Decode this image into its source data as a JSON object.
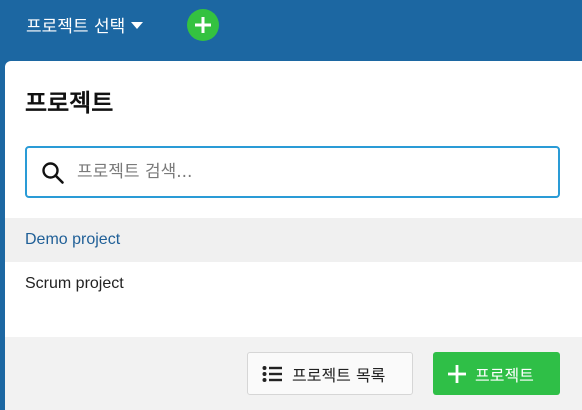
{
  "topbar": {
    "project_select_label": "프로젝트 선택",
    "add_icon": "plus-circle-icon"
  },
  "panel": {
    "title": "프로젝트",
    "search": {
      "placeholder": "프로젝트 검색...",
      "value": ""
    },
    "projects": [
      {
        "label": "Demo project",
        "state": "active"
      },
      {
        "label": "Scrum project",
        "state": "normal"
      }
    ],
    "footer": {
      "list_button_label": "프로젝트 목록",
      "add_button_label": "프로젝트"
    }
  },
  "colors": {
    "topbar": "#1c67a2",
    "accent_green": "#2fbf47",
    "search_border": "#2a9bd6",
    "active_link": "#1f5f97"
  }
}
